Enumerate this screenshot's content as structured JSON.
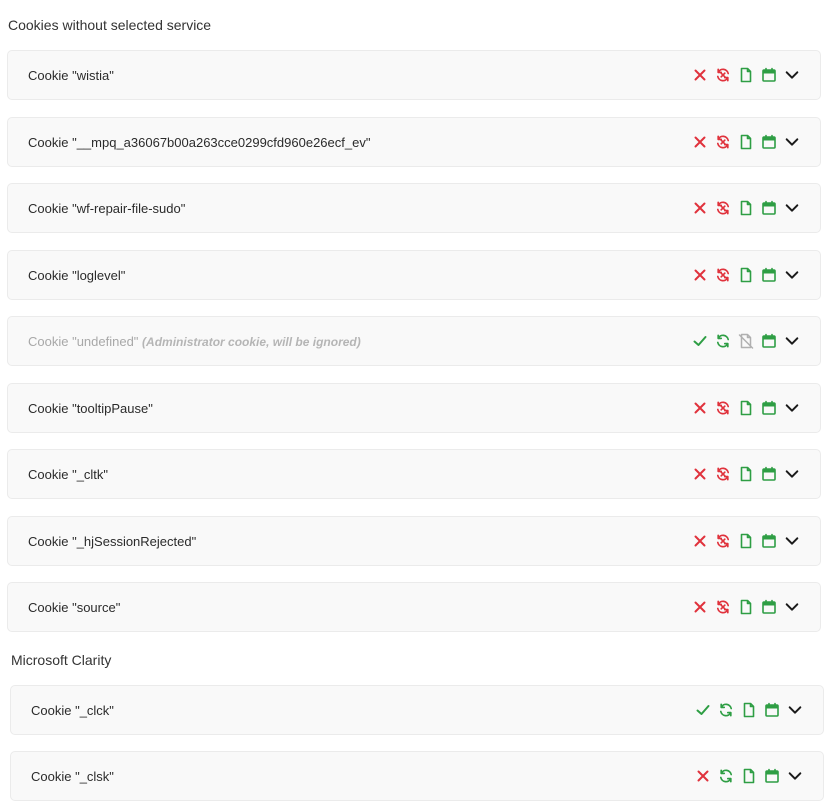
{
  "colors": {
    "red": "#e0323c",
    "green": "#2e9e44",
    "grey": "#b0b0b0",
    "dark": "#1a1a1a"
  },
  "sections": [
    {
      "title": "Cookies without selected service",
      "items": [
        {
          "prefix": "Cookie ",
          "name": "\"wistia\"",
          "note": "",
          "consent": "rejected",
          "sync": "rejected",
          "file": "active"
        },
        {
          "prefix": "Cookie ",
          "name": "\"__mpq_a36067b00a263cce0299cfd960e26ecf_ev\"",
          "note": "",
          "consent": "rejected",
          "sync": "rejected",
          "file": "active"
        },
        {
          "prefix": "Cookie ",
          "name": "\"wf-repair-file-sudo\"",
          "note": "",
          "consent": "rejected",
          "sync": "rejected",
          "file": "active"
        },
        {
          "prefix": "Cookie ",
          "name": "\"loglevel\"",
          "note": "",
          "consent": "rejected",
          "sync": "rejected",
          "file": "active"
        },
        {
          "prefix": "Cookie ",
          "name": "\"undefined\"",
          "note": "(Administrator cookie, will be ignored)",
          "consent": "accepted",
          "sync": "accepted",
          "file": "disabled",
          "disabled": true
        },
        {
          "prefix": "Cookie ",
          "name": "\"tooltipPause\"",
          "note": "",
          "consent": "rejected",
          "sync": "rejected",
          "file": "active"
        },
        {
          "prefix": "Cookie ",
          "name": "\"_cltk\"",
          "note": "",
          "consent": "rejected",
          "sync": "rejected",
          "file": "active"
        },
        {
          "prefix": "Cookie ",
          "name": "\"_hjSessionRejected\"",
          "note": "",
          "consent": "rejected",
          "sync": "rejected",
          "file": "active"
        },
        {
          "prefix": "Cookie ",
          "name": "\"source\"",
          "note": "",
          "consent": "rejected",
          "sync": "rejected",
          "file": "active"
        }
      ]
    },
    {
      "title": "Microsoft Clarity",
      "items": [
        {
          "prefix": "Cookie ",
          "name": "\"_clck\"",
          "note": "",
          "consent": "accepted",
          "sync": "accepted",
          "file": "active"
        },
        {
          "prefix": "Cookie ",
          "name": "\"_clsk\"",
          "note": "",
          "consent": "rejected",
          "sync": "accepted",
          "file": "active"
        }
      ]
    }
  ]
}
